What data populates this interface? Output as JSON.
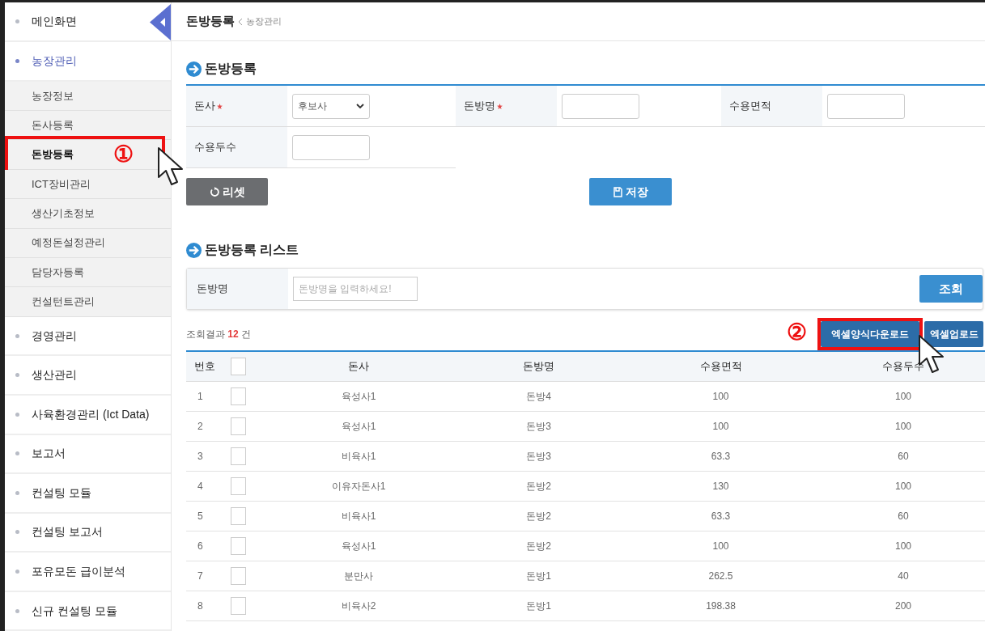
{
  "sidebar": {
    "items": [
      {
        "label": "메인화면",
        "selected": false
      },
      {
        "label": "농장관리",
        "selected": true,
        "children": [
          {
            "label": "농장정보",
            "selected": false
          },
          {
            "label": "돈사등록",
            "selected": false
          },
          {
            "label": "돈방등록",
            "selected": true,
            "annotation": "①"
          },
          {
            "label": "ICT장비관리",
            "selected": false
          },
          {
            "label": "생산기초정보",
            "selected": false
          },
          {
            "label": "예정돈설정관리",
            "selected": false
          },
          {
            "label": "담당자등록",
            "selected": false
          },
          {
            "label": "컨설턴트관리",
            "selected": false
          }
        ]
      },
      {
        "label": "경영관리",
        "selected": false
      },
      {
        "label": "생산관리",
        "selected": false
      },
      {
        "label": "사육환경관리 (Ict Data)",
        "selected": false
      },
      {
        "label": "보고서",
        "selected": false
      },
      {
        "label": "컨설팅 모듈",
        "selected": false
      },
      {
        "label": "컨설팅 보고서",
        "selected": false
      },
      {
        "label": "포유모돈 급이분석",
        "selected": false
      },
      {
        "label": "신규 컨설팅 모듈",
        "selected": false
      }
    ]
  },
  "breadcrumb": {
    "title": "돈방등록",
    "parent": "농장관리"
  },
  "form": {
    "title": "돈방등록",
    "fields": [
      {
        "label": "돈사",
        "required": true,
        "kind": "select",
        "value": "후보사"
      },
      {
        "label": "돈방명",
        "required": true,
        "kind": "text"
      },
      {
        "label": "수용면적",
        "required": false,
        "kind": "text"
      },
      {
        "label": "수용두수",
        "required": false,
        "kind": "text"
      }
    ],
    "reset_button": "리셋",
    "save_button": "저장"
  },
  "list": {
    "title": "돈방등록 리스트",
    "search": {
      "label": "돈방명",
      "placeholder": "돈방명을 입력하세요!",
      "button": "조회"
    },
    "result": {
      "prefix": "조회결과",
      "count": "12",
      "suffix": "건"
    },
    "buttons": [
      {
        "label": "엑셀양식다운로드",
        "annotation": "②"
      },
      {
        "label": "엑셀업로드"
      }
    ],
    "table": {
      "columns": [
        "번호",
        "돈사",
        "돈방명",
        "수용면적",
        "수용두수"
      ],
      "header_checked": false,
      "rows": [
        {
          "no": "1",
          "checked": false,
          "pen": "육성사1",
          "room": "돈방4",
          "area": "100",
          "heads": "100"
        },
        {
          "no": "2",
          "checked": false,
          "pen": "육성사1",
          "room": "돈방3",
          "area": "100",
          "heads": "100"
        },
        {
          "no": "3",
          "checked": false,
          "pen": "비육사1",
          "room": "돈방3",
          "area": "63.3",
          "heads": "60"
        },
        {
          "no": "4",
          "checked": false,
          "pen": "이유자돈사1",
          "room": "돈방2",
          "area": "130",
          "heads": "100"
        },
        {
          "no": "5",
          "checked": false,
          "pen": "비육사1",
          "room": "돈방2",
          "area": "63.3",
          "heads": "60"
        },
        {
          "no": "6",
          "checked": false,
          "pen": "육성사1",
          "room": "돈방2",
          "area": "100",
          "heads": "100"
        },
        {
          "no": "7",
          "checked": false,
          "pen": "분만사",
          "room": "돈방1",
          "area": "262.5",
          "heads": "40"
        },
        {
          "no": "8",
          "checked": false,
          "pen": "비육사2",
          "room": "돈방1",
          "area": "198.38",
          "heads": "200"
        }
      ]
    }
  }
}
